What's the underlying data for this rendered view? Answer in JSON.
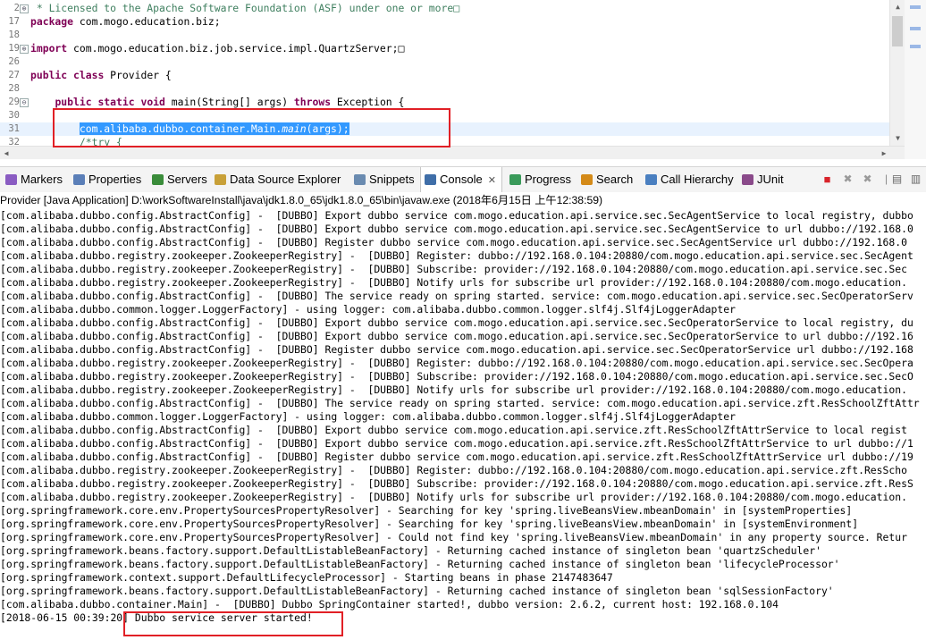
{
  "editor": {
    "lines": [
      {
        "num": "2",
        "fold": "⊕",
        "parts": [
          {
            "t": " * Licensed to the Apache Software Foundation (ASF) under one or more",
            "c": "cm"
          },
          {
            "t": "□",
            "c": "cm"
          }
        ]
      },
      {
        "num": "17",
        "parts": [
          {
            "t": "package",
            "c": "kw"
          },
          {
            "t": " com.mogo.education.biz;"
          }
        ]
      },
      {
        "num": "18",
        "parts": []
      },
      {
        "num": "19",
        "fold": "⊕",
        "parts": [
          {
            "t": "import",
            "c": "kw"
          },
          {
            "t": " com.mogo.education.biz.job.service.impl.QuartzServer;□"
          }
        ]
      },
      {
        "num": "26",
        "parts": []
      },
      {
        "num": "27",
        "parts": [
          {
            "t": "public",
            "c": "kw"
          },
          {
            "t": " "
          },
          {
            "t": "class",
            "c": "kw"
          },
          {
            "t": " Provider {"
          }
        ]
      },
      {
        "num": "28",
        "parts": []
      },
      {
        "num": "29",
        "fold": "⊖",
        "parts": [
          {
            "t": "    "
          },
          {
            "t": "public",
            "c": "kw"
          },
          {
            "t": " "
          },
          {
            "t": "static",
            "c": "kw"
          },
          {
            "t": " "
          },
          {
            "t": "void",
            "c": "kw"
          },
          {
            "t": " main(String[] args) "
          },
          {
            "t": "throws",
            "c": "kw"
          },
          {
            "t": " Exception {"
          }
        ]
      },
      {
        "num": "30",
        "parts": []
      },
      {
        "num": "31",
        "current": true,
        "parts": [
          {
            "t": "        "
          },
          {
            "t": "com.alibaba.dubbo.container.Main.",
            "c": "sel"
          },
          {
            "t": "main",
            "c": "sel it"
          },
          {
            "t": "(args);",
            "c": "sel"
          }
        ]
      },
      {
        "num": "32",
        "parts": [
          {
            "t": "        "
          },
          {
            "t": "/*try {",
            "c": "cm"
          }
        ]
      }
    ]
  },
  "tabs": [
    {
      "label": "Markers",
      "icon": "markers-icon",
      "name": "tab-markers"
    },
    {
      "label": "Properties",
      "icon": "properties-icon",
      "name": "tab-properties"
    },
    {
      "label": "Servers",
      "icon": "servers-icon",
      "name": "tab-servers"
    },
    {
      "label": "Data Source Explorer",
      "icon": "data-source-icon",
      "name": "tab-data-source-explorer"
    },
    {
      "label": "Snippets",
      "icon": "snippets-icon",
      "name": "tab-snippets"
    },
    {
      "label": "Console",
      "icon": "console-icon",
      "name": "tab-console",
      "active": true
    },
    {
      "label": "Progress",
      "icon": "progress-icon",
      "name": "tab-progress"
    },
    {
      "label": "Search",
      "icon": "search-icon",
      "name": "tab-search"
    },
    {
      "label": "Call Hierarchy",
      "icon": "call-hierarchy-icon",
      "name": "tab-call-hierarchy"
    },
    {
      "label": "JUnit",
      "icon": "junit-icon",
      "name": "tab-junit"
    }
  ],
  "console": {
    "description": "Provider [Java Application] D:\\workSoftwareInstall\\java\\jdk1.8.0_65\\jdk1.8.0_65\\bin\\javaw.exe (2018年6月15日 上午12:38:59)",
    "lines": [
      "[com.alibaba.dubbo.config.AbstractConfig] -  [DUBBO] Export dubbo service com.mogo.education.api.service.sec.SecAgentService to local registry, dubbo",
      "[com.alibaba.dubbo.config.AbstractConfig] -  [DUBBO] Export dubbo service com.mogo.education.api.service.sec.SecAgentService to url dubbo://192.168.0",
      "[com.alibaba.dubbo.config.AbstractConfig] -  [DUBBO] Register dubbo service com.mogo.education.api.service.sec.SecAgentService url dubbo://192.168.0",
      "[com.alibaba.dubbo.registry.zookeeper.ZookeeperRegistry] -  [DUBBO] Register: dubbo://192.168.0.104:20880/com.mogo.education.api.service.sec.SecAgent",
      "[com.alibaba.dubbo.registry.zookeeper.ZookeeperRegistry] -  [DUBBO] Subscribe: provider://192.168.0.104:20880/com.mogo.education.api.service.sec.Sec",
      "[com.alibaba.dubbo.registry.zookeeper.ZookeeperRegistry] -  [DUBBO] Notify urls for subscribe url provider://192.168.0.104:20880/com.mogo.education.",
      "[com.alibaba.dubbo.config.AbstractConfig] -  [DUBBO] The service ready on spring started. service: com.mogo.education.api.service.sec.SecOperatorServ",
      "[com.alibaba.dubbo.common.logger.LoggerFactory] - using logger: com.alibaba.dubbo.common.logger.slf4j.Slf4jLoggerAdapter",
      "[com.alibaba.dubbo.config.AbstractConfig] -  [DUBBO] Export dubbo service com.mogo.education.api.service.sec.SecOperatorService to local registry, du",
      "[com.alibaba.dubbo.config.AbstractConfig] -  [DUBBO] Export dubbo service com.mogo.education.api.service.sec.SecOperatorService to url dubbo://192.16",
      "[com.alibaba.dubbo.config.AbstractConfig] -  [DUBBO] Register dubbo service com.mogo.education.api.service.sec.SecOperatorService url dubbo://192.168",
      "[com.alibaba.dubbo.registry.zookeeper.ZookeeperRegistry] -  [DUBBO] Register: dubbo://192.168.0.104:20880/com.mogo.education.api.service.sec.SecOpera",
      "[com.alibaba.dubbo.registry.zookeeper.ZookeeperRegistry] -  [DUBBO] Subscribe: provider://192.168.0.104:20880/com.mogo.education.api.service.sec.SecO",
      "[com.alibaba.dubbo.registry.zookeeper.ZookeeperRegistry] -  [DUBBO] Notify urls for subscribe url provider://192.168.0.104:20880/com.mogo.education.",
      "[com.alibaba.dubbo.config.AbstractConfig] -  [DUBBO] The service ready on spring started. service: com.mogo.education.api.service.zft.ResSchoolZftAttr",
      "[com.alibaba.dubbo.common.logger.LoggerFactory] - using logger: com.alibaba.dubbo.common.logger.slf4j.Slf4jLoggerAdapter",
      "[com.alibaba.dubbo.config.AbstractConfig] -  [DUBBO] Export dubbo service com.mogo.education.api.service.zft.ResSchoolZftAttrService to local regist",
      "[com.alibaba.dubbo.config.AbstractConfig] -  [DUBBO] Export dubbo service com.mogo.education.api.service.zft.ResSchoolZftAttrService to url dubbo://1",
      "[com.alibaba.dubbo.config.AbstractConfig] -  [DUBBO] Register dubbo service com.mogo.education.api.service.zft.ResSchoolZftAttrService url dubbo://19",
      "[com.alibaba.dubbo.registry.zookeeper.ZookeeperRegistry] -  [DUBBO] Register: dubbo://192.168.0.104:20880/com.mogo.education.api.service.zft.ResScho",
      "[com.alibaba.dubbo.registry.zookeeper.ZookeeperRegistry] -  [DUBBO] Subscribe: provider://192.168.0.104:20880/com.mogo.education.api.service.zft.ResS",
      "[com.alibaba.dubbo.registry.zookeeper.ZookeeperRegistry] -  [DUBBO] Notify urls for subscribe url provider://192.168.0.104:20880/com.mogo.education.",
      "[org.springframework.core.env.PropertySourcesPropertyResolver] - Searching for key 'spring.liveBeansView.mbeanDomain' in [systemProperties]",
      "[org.springframework.core.env.PropertySourcesPropertyResolver] - Searching for key 'spring.liveBeansView.mbeanDomain' in [systemEnvironment]",
      "[org.springframework.core.env.PropertySourcesPropertyResolver] - Could not find key 'spring.liveBeansView.mbeanDomain' in any property source. Retur",
      "[org.springframework.beans.factory.support.DefaultListableBeanFactory] - Returning cached instance of singleton bean 'quartzScheduler'",
      "[org.springframework.beans.factory.support.DefaultListableBeanFactory] - Returning cached instance of singleton bean 'lifecycleProcessor'",
      "[org.springframework.context.support.DefaultLifecycleProcessor] - Starting beans in phase 2147483647",
      "[org.springframework.beans.factory.support.DefaultListableBeanFactory] - Returning cached instance of singleton bean 'sqlSessionFactory'",
      "[com.alibaba.dubbo.container.Main] -  [DUBBO] Dubbo SpringContainer started!, dubbo version: 2.6.2, current host: 192.168.0.104",
      "[2018-06-15 00:39:20] Dubbo service server started!"
    ]
  },
  "colors": {
    "highlight_box": "#e12026",
    "selection": "#3399ff",
    "keyword": "#7f0055",
    "comment": "#3f7f5f"
  }
}
